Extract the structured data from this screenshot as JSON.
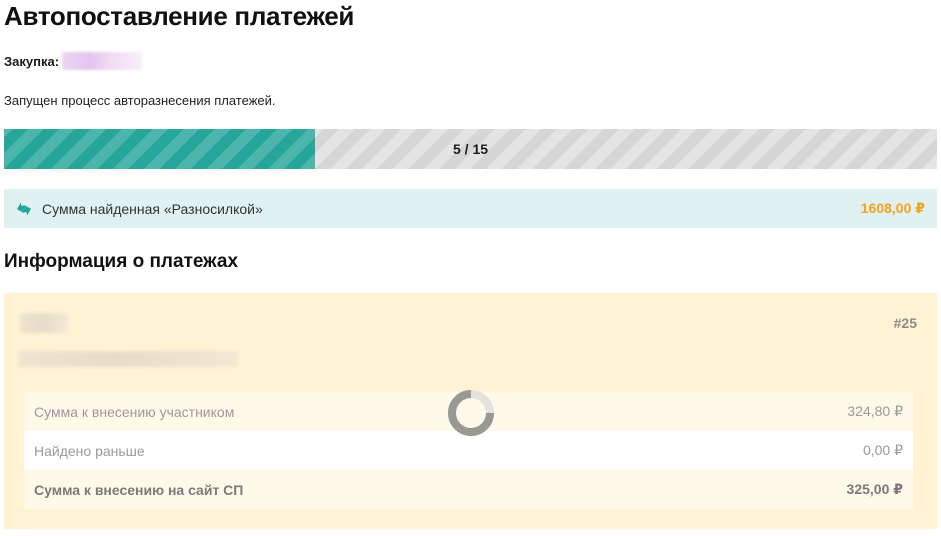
{
  "page": {
    "title": "Автопоставление платежей"
  },
  "purchase": {
    "label": "Закупка:"
  },
  "status": {
    "text": "Запущен процесс авторазнесения платежей."
  },
  "progress": {
    "current": 5,
    "total": 15,
    "label": "5 / 15",
    "fill_color": "#26a69a"
  },
  "found": {
    "icon": "sync-arrows-icon",
    "label": "Сумма найденная «Разносилкой»",
    "amount": "1608,00 ₽",
    "amount_color": "#f7a21b"
  },
  "payments_section": {
    "title": "Информация о платежах"
  },
  "payment_card": {
    "number": "#25",
    "rows": [
      {
        "label": "Сумма к внесению участником",
        "value": "324,80 ₽"
      },
      {
        "label": "Найдено раньше",
        "value": "0,00 ₽"
      },
      {
        "label": "Сумма к внесению на сайт СП",
        "value": "325,00 ₽"
      }
    ]
  },
  "loading": {
    "icon": "loading-spinner-icon"
  }
}
